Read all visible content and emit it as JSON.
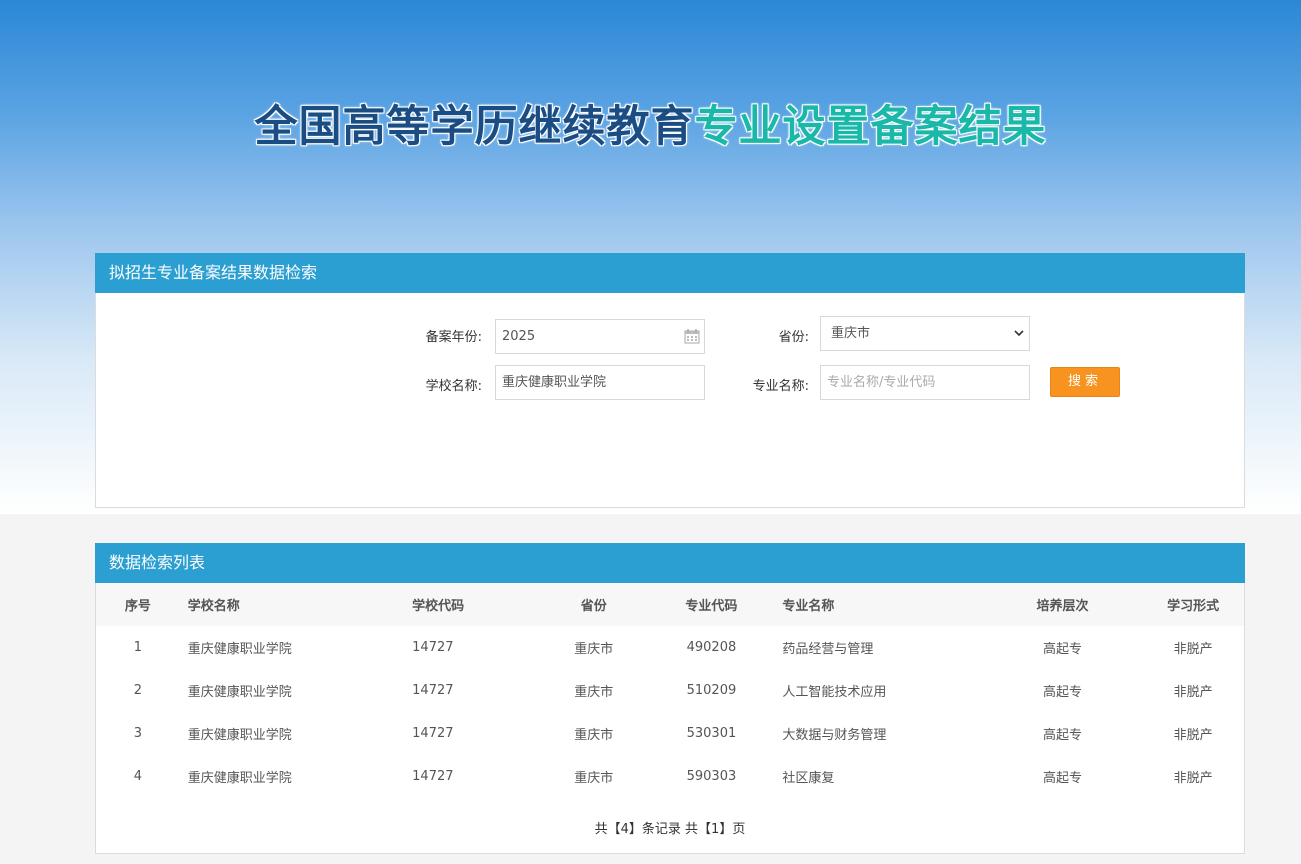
{
  "banner": {
    "title_part1": "全国高等学历继续教育",
    "title_part2": "专业设置备案结果"
  },
  "search": {
    "header": "拟招生专业备案结果数据检索",
    "year_label": "备案年份:",
    "year_value": "2025",
    "province_label": "省份:",
    "province_value": "重庆市",
    "school_label": "学校名称:",
    "school_value": "重庆健康职业学院",
    "major_label": "专业名称:",
    "major_placeholder": "专业名称/专业代码",
    "search_button": "搜索"
  },
  "list": {
    "header": "数据检索列表",
    "columns": [
      "序号",
      "学校名称",
      "学校代码",
      "省份",
      "专业代码",
      "专业名称",
      "培养层次",
      "学习形式"
    ],
    "rows": [
      [
        "1",
        "重庆健康职业学院",
        "14727",
        "重庆市",
        "490208",
        "药品经营与管理",
        "高起专",
        "非脱产"
      ],
      [
        "2",
        "重庆健康职业学院",
        "14727",
        "重庆市",
        "510209",
        "人工智能技术应用",
        "高起专",
        "非脱产"
      ],
      [
        "3",
        "重庆健康职业学院",
        "14727",
        "重庆市",
        "530301",
        "大数据与财务管理",
        "高起专",
        "非脱产"
      ],
      [
        "4",
        "重庆健康职业学院",
        "14727",
        "重庆市",
        "590303",
        "社区康复",
        "高起专",
        "非脱产"
      ]
    ],
    "pager": "共【4】条记录 共【1】页"
  },
  "colors": {
    "panel_header": "#2b9fd1",
    "search_button": "#f7931e",
    "title_dark": "#1a4d84",
    "title_teal": "#1ab8a8"
  },
  "icons": {
    "year_field": "calendar-icon",
    "province_select": "chevron-down-icon"
  }
}
